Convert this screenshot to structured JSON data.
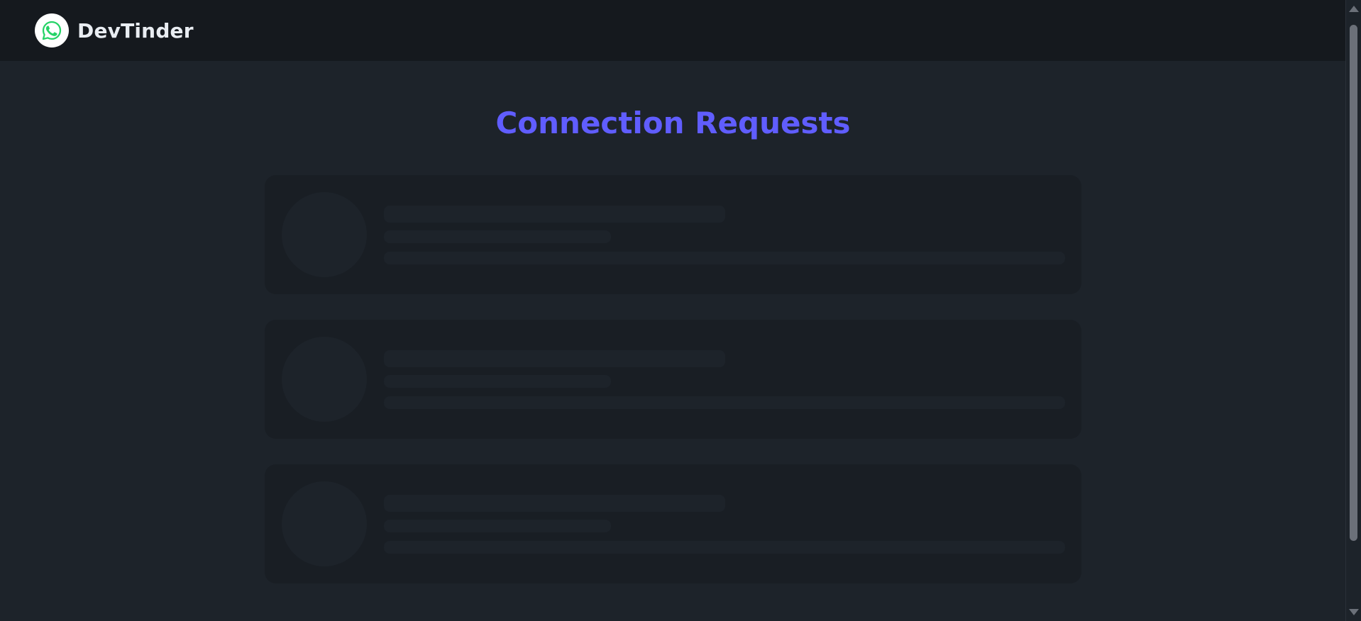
{
  "navbar": {
    "brand_name": "DevTinder",
    "logo_icon": "whatsapp-icon",
    "background": "#15191e"
  },
  "main": {
    "title": "Connection Requests",
    "title_color": "#605dff",
    "skeleton_cards": 3
  },
  "colors": {
    "page_background": "#1d232a",
    "card_background": "#191e24",
    "skeleton_block": "#1d232a",
    "logo_green": "#25d366"
  }
}
